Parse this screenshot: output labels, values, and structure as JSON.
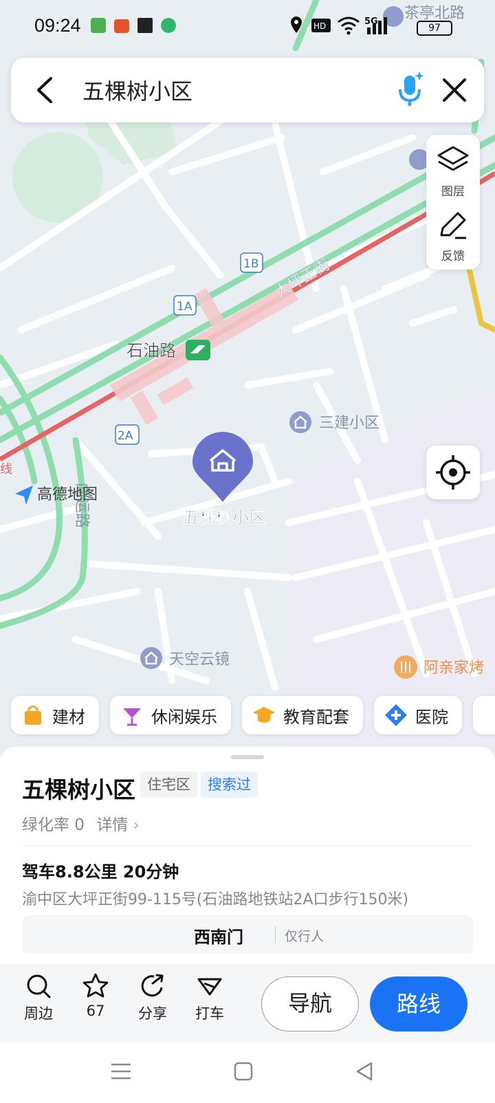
{
  "status_bar": {
    "time": "09:24",
    "network": "5G",
    "battery": "97"
  },
  "search": {
    "query": "五棵树小区"
  },
  "map_tools": {
    "layers_label": "图层",
    "feedback_label": "反馈"
  },
  "map_labels": {
    "road_tea": "茶亭北路",
    "road_main": "大坪正街",
    "station": "石油路",
    "exit_1a": "1A",
    "exit_1b": "1B",
    "exit_2a": "2A",
    "sanjian": "三建小区",
    "selected_place": "五棵树小区",
    "tiankong": "天空云镜",
    "bbq": "阿亲家烤",
    "logo": "高德地图",
    "road_left": "向运路",
    "line_fragment": "线"
  },
  "chips": [
    {
      "label": "建材",
      "icon": "shopping-bag-icon",
      "color": "#f5a623"
    },
    {
      "label": "休闲娱乐",
      "icon": "cocktail-icon",
      "color": "#b44fd6"
    },
    {
      "label": "教育配套",
      "icon": "graduation-cap-icon",
      "color": "#f5a623"
    },
    {
      "label": "医院",
      "icon": "medical-cross-icon",
      "color": "#2f7cf6"
    }
  ],
  "place": {
    "name": "五棵树小区",
    "tag_type": "住宅区",
    "tag_history": "搜索过",
    "green_rate": "绿化率 0",
    "details": "详情",
    "drive_info": "驾车8.8公里 20分钟",
    "address": "渝中区大坪正街99-115号(石油路地铁站2A口步行150米)",
    "gate_name": "西南门",
    "gate_desc": "仅行人"
  },
  "actions": {
    "nearby": "周边",
    "favorites_count": "67",
    "share": "分享",
    "taxi": "打车",
    "navigate": "导航",
    "route": "路线"
  },
  "colors": {
    "accent": "#1a73f5",
    "marker": "#6a72cc",
    "traffic_red": "#e05555",
    "traffic_green": "#7dd9a0"
  }
}
